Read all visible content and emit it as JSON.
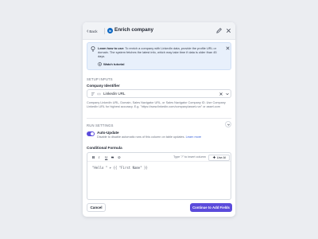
{
  "header": {
    "back_label": "Back",
    "title": "Enrich company",
    "badge_letters": "in"
  },
  "info_banner": {
    "lead": "Learn how to use:",
    "text": " To enrich a company with LinkedIn data, provide the profile URL or domain. The system fetches the latest info, which may take time if data is older than 45 days.",
    "tutorial_label": "Watch tutorial"
  },
  "setup": {
    "section_label": "SETUP INPUTS",
    "field_label": "Company Identifier",
    "selected_value": "Linkedin URL",
    "help_text": "Company LinkedIn URL, Domain, Sales Navigator URL, or Sales Navigator Company ID. Use Company LinkedIn URL for highest accuracy. E.g. \"https://www.linkedin.com/company/asset-run\" or asset.com"
  },
  "run_settings": {
    "section_label": "RUN SETTINGS",
    "auto_update_label": "Auto-Update",
    "auto_update_desc": "Disable to disable automatic runs of this column on table updates.",
    "learn_more": "Learn more",
    "auto_update_on": true
  },
  "formula": {
    "label": "Conditional Formula",
    "toolbar": [
      "B",
      "I",
      "U",
      "S",
      "⊘"
    ],
    "hint": "Type \"/\" to insert column",
    "ai_button": "Use AI",
    "code": "\"Hello \" + {{ \"First Name\" }}"
  },
  "footer": {
    "cancel_label": "Cancel",
    "continue_label": "Continue to Add Fields"
  },
  "colors": {
    "accent": "#5b4bdb",
    "linkedin": "#0a66c2",
    "info_bg": "#e8f0fb"
  }
}
